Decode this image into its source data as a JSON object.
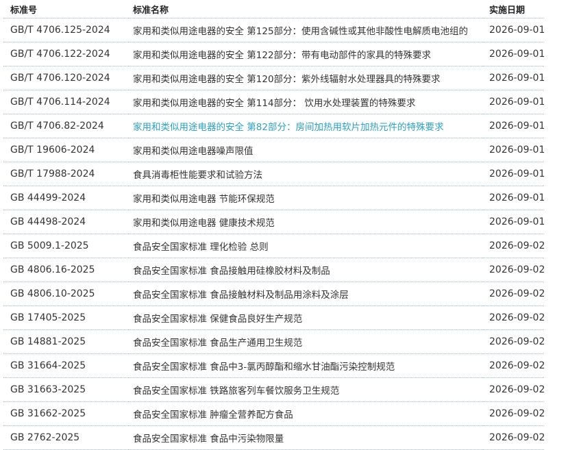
{
  "header": {
    "col_number": "标准号",
    "col_name": "标准名称",
    "col_date": "实施日期"
  },
  "colors": {
    "highlight": "#2aa0c8",
    "separator": "#9ab6cf"
  },
  "rows": [
    {
      "number": "GB/T 4706.125-2024",
      "name": "家用和类似用途电器的安全 第125部分：使用含碱性或其他非酸性电解质电池组的",
      "date": "2026-09-01",
      "highlighted": false
    },
    {
      "number": "GB/T 4706.122-2024",
      "name": "家用和类似用途电器的安全 第122部分：带有电动部件的家具的特殊要求",
      "date": "2026-09-01",
      "highlighted": false
    },
    {
      "number": "GB/T 4706.120-2024",
      "name": "家用和类似用途电器的安全 第120部分：紫外线辐射水处理器具的特殊要求",
      "date": "2026-09-01",
      "highlighted": false
    },
    {
      "number": "GB/T 4706.114-2024",
      "name": "家用和类似用途电器的安全 第114部分： 饮用水处理装置的特殊要求",
      "date": "2026-09-01",
      "highlighted": false
    },
    {
      "number": "GB/T 4706.82-2024",
      "name": "家用和类似用途电器的安全 第82部分：房间加热用软片加热元件的特殊要求",
      "date": "2026-09-01",
      "highlighted": true
    },
    {
      "number": "GB/T 19606-2024",
      "name": "家用和类似用途电器噪声限值",
      "date": "2026-09-01",
      "highlighted": false
    },
    {
      "number": "GB/T 17988-2024",
      "name": "食具消毒柜性能要求和试验方法",
      "date": "2026-09-01",
      "highlighted": false
    },
    {
      "number": "GB 44499-2024",
      "name": "家用和类似用途电器 节能环保规范",
      "date": "2026-09-01",
      "highlighted": false
    },
    {
      "number": "GB 44498-2024",
      "name": "家用和类似用途电器 健康技术规范",
      "date": "2026-09-01",
      "highlighted": false
    },
    {
      "number": "GB 5009.1-2025",
      "name": "食品安全国家标准 理化检验 总则",
      "date": "2026-09-02",
      "highlighted": false
    },
    {
      "number": "GB 4806.16-2025",
      "name": "食品安全国家标准 食品接触用硅橡胶材料及制品",
      "date": "2026-09-02",
      "highlighted": false
    },
    {
      "number": "GB 4806.10-2025",
      "name": "食品安全国家标准 食品接触材料及制品用涂料及涂层",
      "date": "2026-09-02",
      "highlighted": false
    },
    {
      "number": "GB 17405-2025",
      "name": "食品安全国家标准 保健食品良好生产规范",
      "date": "2026-09-02",
      "highlighted": false
    },
    {
      "number": "GB 14881-2025",
      "name": "食品安全国家标准 食品生产通用卫生规范",
      "date": "2026-09-02",
      "highlighted": false
    },
    {
      "number": "GB 31664-2025",
      "name": "食品安全国家标准 食品中3-氯丙醇酯和缩水甘油酯污染控制规范",
      "date": "2026-09-02",
      "highlighted": false
    },
    {
      "number": "GB 31663-2025",
      "name": "食品安全国家标准 铁路旅客列车餐饮服务卫生规范",
      "date": "2026-09-02",
      "highlighted": false
    },
    {
      "number": "GB 31662-2025",
      "name": "食品安全国家标准 肿瘤全营养配方食品",
      "date": "2026-09-02",
      "highlighted": false
    },
    {
      "number": "GB 2762-2025",
      "name": "食品安全国家标准 食品中污染物限量",
      "date": "2026-09-02",
      "highlighted": false
    }
  ]
}
